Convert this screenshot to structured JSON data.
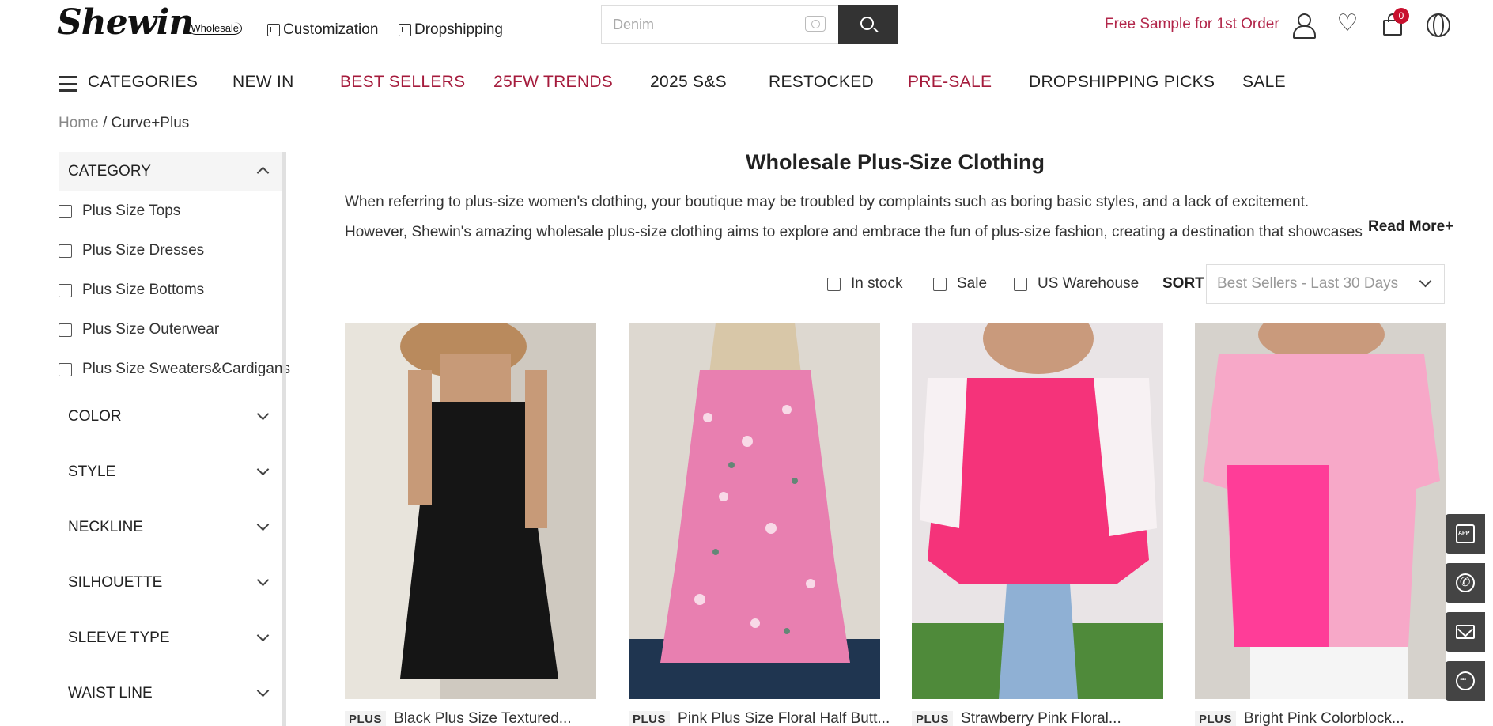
{
  "header": {
    "logo_main": "Shewin",
    "logo_sub": "Wholesale",
    "links": [
      {
        "label": "Customization",
        "icon": "customization-icon"
      },
      {
        "label": "Dropshipping",
        "icon": "dropshipping-icon"
      }
    ],
    "search": {
      "placeholder": "Denim"
    },
    "free_sample": "Free Sample for 1st Order",
    "cart_count": "0"
  },
  "nav": {
    "categories_label": "CATEGORIES",
    "items": [
      {
        "label": "NEW IN"
      },
      {
        "label": "BEST SELLERS"
      },
      {
        "label": "25FW TRENDS"
      },
      {
        "label": "2025 S&S"
      },
      {
        "label": "RESTOCKED"
      },
      {
        "label": "PRE-SALE"
      },
      {
        "label": "DROPSHIPPING PICKS"
      },
      {
        "label": "SALE"
      }
    ]
  },
  "breadcrumb": {
    "home": "Home",
    "sep": " / ",
    "current": "Curve+Plus"
  },
  "sidebar": {
    "category_label": "CATEGORY",
    "categories": [
      {
        "label": "Plus Size Tops"
      },
      {
        "label": "Plus Size Dresses"
      },
      {
        "label": "Plus Size Bottoms"
      },
      {
        "label": "Plus Size Outerwear"
      },
      {
        "label": "Plus Size Sweaters&Cardigans"
      }
    ],
    "filters": [
      {
        "label": "COLOR"
      },
      {
        "label": "STYLE"
      },
      {
        "label": "NECKLINE"
      },
      {
        "label": "SILHOUETTE"
      },
      {
        "label": "SLEEVE TYPE"
      },
      {
        "label": "WAIST LINE"
      }
    ]
  },
  "main": {
    "title": "Wholesale Plus-Size Clothing",
    "description": "When referring to plus-size women's clothing, your boutique may be troubled by complaints such as boring basic styles, and a lack of excitement. However, Shewin's amazing wholesale plus-size clothing aims to explore and embrace the fun of plus-size fashion, creating a destination that showcases the unique style for your",
    "read_more": "Read More+",
    "filter_checks": [
      {
        "label": "In stock"
      },
      {
        "label": "Sale"
      },
      {
        "label": "US Warehouse"
      }
    ],
    "sort_label": "SORT",
    "sort_value": "Best Sellers - Last 30 Days"
  },
  "products": [
    {
      "tag": "PLUS",
      "title": "Black Plus Size Textured...",
      "color": "#1a1a1a"
    },
    {
      "tag": "PLUS",
      "title": "Pink Plus Size Floral Half Butt...",
      "color": "#e05a9a"
    },
    {
      "tag": "PLUS",
      "title": "Strawberry Pink Floral...",
      "color": "#f0307a"
    },
    {
      "tag": "PLUS",
      "title": "Bright Pink Colorblock...",
      "color": "#ff4fa3"
    }
  ],
  "colors": {
    "accent_red": "#a51b3c",
    "dark": "#333333"
  }
}
